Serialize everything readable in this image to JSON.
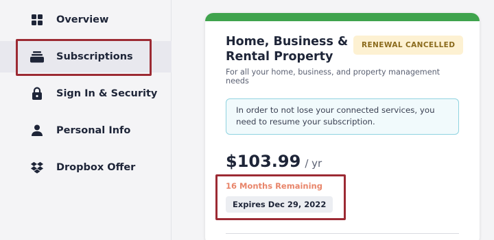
{
  "sidebar": {
    "items": [
      {
        "label": "Overview",
        "icon": "grid-icon"
      },
      {
        "label": "Subscriptions",
        "icon": "stack-icon",
        "active": true
      },
      {
        "label": "Sign In & Security",
        "icon": "lock-icon"
      },
      {
        "label": "Personal Info",
        "icon": "person-icon"
      },
      {
        "label": "Dropbox Offer",
        "icon": "dropbox-icon"
      }
    ]
  },
  "plan": {
    "title_line1": "Home, Business &",
    "title_line2": "Rental Property",
    "badge": "RENEWAL CANCELLED",
    "description": "For all your home, business, and property management needs",
    "notice": "In order to not lose your connected services, you need to resume your subscription.",
    "price": "$103.99",
    "period": "/ yr",
    "remaining": "16 Months Remaining",
    "expires": "Expires Dec 29, 2022"
  },
  "colors": {
    "accent_bar": "#3fa34d",
    "annotation": "#9c2a33",
    "badge_bg": "#fdf1d2",
    "remaining_text": "#e8856a",
    "notice_border": "#8fd3e0"
  }
}
